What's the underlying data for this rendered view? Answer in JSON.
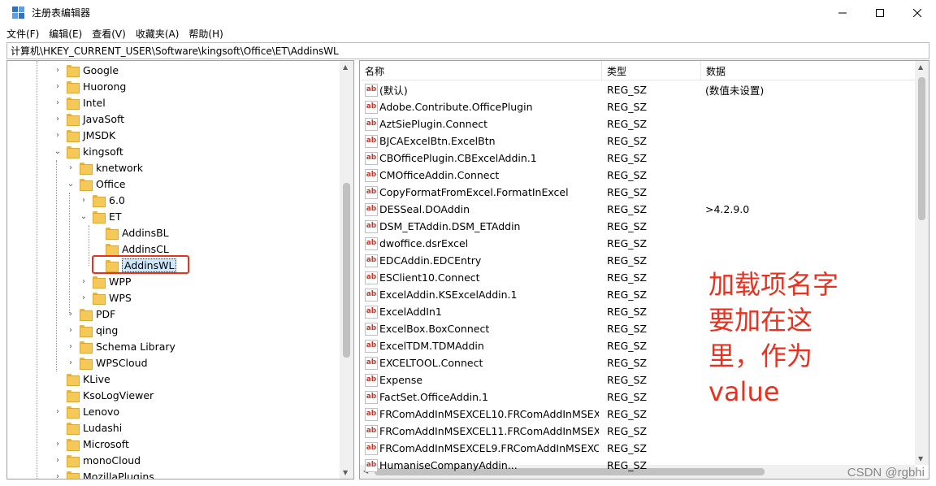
{
  "window": {
    "title": "注册表编辑器"
  },
  "menu": [
    "文件(F)",
    "编辑(E)",
    "查看(V)",
    "收藏夹(A)",
    "帮助(H)"
  ],
  "address": "计算机\\HKEY_CURRENT_USER\\Software\\kingsoft\\Office\\ET\\AddinsWL",
  "tree": [
    {
      "label": "Google",
      "depth": 0,
      "expander": ">"
    },
    {
      "label": "Huorong",
      "depth": 0,
      "expander": ">"
    },
    {
      "label": "Intel",
      "depth": 0,
      "expander": ">"
    },
    {
      "label": "JavaSoft",
      "depth": 0,
      "expander": ">"
    },
    {
      "label": "JMSDK",
      "depth": 0,
      "expander": ">"
    },
    {
      "label": "kingsoft",
      "depth": 0,
      "expander": "v"
    },
    {
      "label": "knetwork",
      "depth": 1,
      "expander": ">"
    },
    {
      "label": "Office",
      "depth": 1,
      "expander": "v"
    },
    {
      "label": "6.0",
      "depth": 2,
      "expander": ">"
    },
    {
      "label": "ET",
      "depth": 2,
      "expander": "v"
    },
    {
      "label": "AddinsBL",
      "depth": 3,
      "expander": ""
    },
    {
      "label": "AddinsCL",
      "depth": 3,
      "expander": ""
    },
    {
      "label": "AddinsWL",
      "depth": 3,
      "expander": "",
      "selected": true
    },
    {
      "label": "WPP",
      "depth": 2,
      "expander": ">"
    },
    {
      "label": "WPS",
      "depth": 2,
      "expander": ">"
    },
    {
      "label": "PDF",
      "depth": 1,
      "expander": ">"
    },
    {
      "label": "qing",
      "depth": 1,
      "expander": ">"
    },
    {
      "label": "Schema Library",
      "depth": 1,
      "expander": ">"
    },
    {
      "label": "WPSCloud",
      "depth": 1,
      "expander": ">"
    },
    {
      "label": "KLive",
      "depth": 0,
      "expander": ""
    },
    {
      "label": "KsoLogViewer",
      "depth": 0,
      "expander": ""
    },
    {
      "label": "Lenovo",
      "depth": 0,
      "expander": ">"
    },
    {
      "label": "Ludashi",
      "depth": 0,
      "expander": ""
    },
    {
      "label": "Microsoft",
      "depth": 0,
      "expander": ">"
    },
    {
      "label": "monoCloud",
      "depth": 0,
      "expander": ">"
    },
    {
      "label": "MozillaPlugins",
      "depth": 0,
      "expander": ">"
    }
  ],
  "list": {
    "columns": [
      "名称",
      "类型",
      "数据"
    ],
    "rows": [
      {
        "name": "(默认)",
        "type": "REG_SZ",
        "data": "(数值未设置)"
      },
      {
        "name": "Adobe.Contribute.OfficePlugin",
        "type": "REG_SZ",
        "data": ""
      },
      {
        "name": "AztSiePlugin.Connect",
        "type": "REG_SZ",
        "data": ""
      },
      {
        "name": "BJCAExcelBtn.ExcelBtn",
        "type": "REG_SZ",
        "data": ""
      },
      {
        "name": "CBOfficePlugin.CBExcelAddin.1",
        "type": "REG_SZ",
        "data": ""
      },
      {
        "name": "CMOfficeAddin.Connect",
        "type": "REG_SZ",
        "data": ""
      },
      {
        "name": "CopyFormatFromExcel.FormatInExcel",
        "type": "REG_SZ",
        "data": ""
      },
      {
        "name": "DESSeal.DOAddin",
        "type": "REG_SZ",
        "data": ">4.2.9.0"
      },
      {
        "name": "DSM_ETAddin.DSM_ETAddin",
        "type": "REG_SZ",
        "data": ""
      },
      {
        "name": "dwoffice.dsrExcel",
        "type": "REG_SZ",
        "data": ""
      },
      {
        "name": "EDCAddin.EDCEntry",
        "type": "REG_SZ",
        "data": ""
      },
      {
        "name": "ESClient10.Connect",
        "type": "REG_SZ",
        "data": ""
      },
      {
        "name": "ExcelAddin.KSExcelAddin.1",
        "type": "REG_SZ",
        "data": ""
      },
      {
        "name": "ExcelAddIn1",
        "type": "REG_SZ",
        "data": ""
      },
      {
        "name": "ExcelBox.BoxConnect",
        "type": "REG_SZ",
        "data": ""
      },
      {
        "name": "ExcelTDM.TDMAddin",
        "type": "REG_SZ",
        "data": ""
      },
      {
        "name": "EXCELTOOL.Connect",
        "type": "REG_SZ",
        "data": ""
      },
      {
        "name": "Expense",
        "type": "REG_SZ",
        "data": ""
      },
      {
        "name": "FactSet.OfficeAddin.1",
        "type": "REG_SZ",
        "data": ""
      },
      {
        "name": "FRComAddInMSEXCEL10.FRComAddInMSEX...",
        "type": "REG_SZ",
        "data": ""
      },
      {
        "name": "FRComAddInMSEXCEL11.FRComAddInMSEX...",
        "type": "REG_SZ",
        "data": ""
      },
      {
        "name": "FRComAddInMSEXCEL9.FRComAddInMSEXC...",
        "type": "REG_SZ",
        "data": ""
      },
      {
        "name": "HumaniseCompanyAddin...",
        "type": "REG_SZ",
        "data": ""
      }
    ]
  },
  "annotation": [
    "加载项名字",
    "要加在这",
    "里，作为",
    "value"
  ],
  "watermark": "CSDN @rgbhi"
}
